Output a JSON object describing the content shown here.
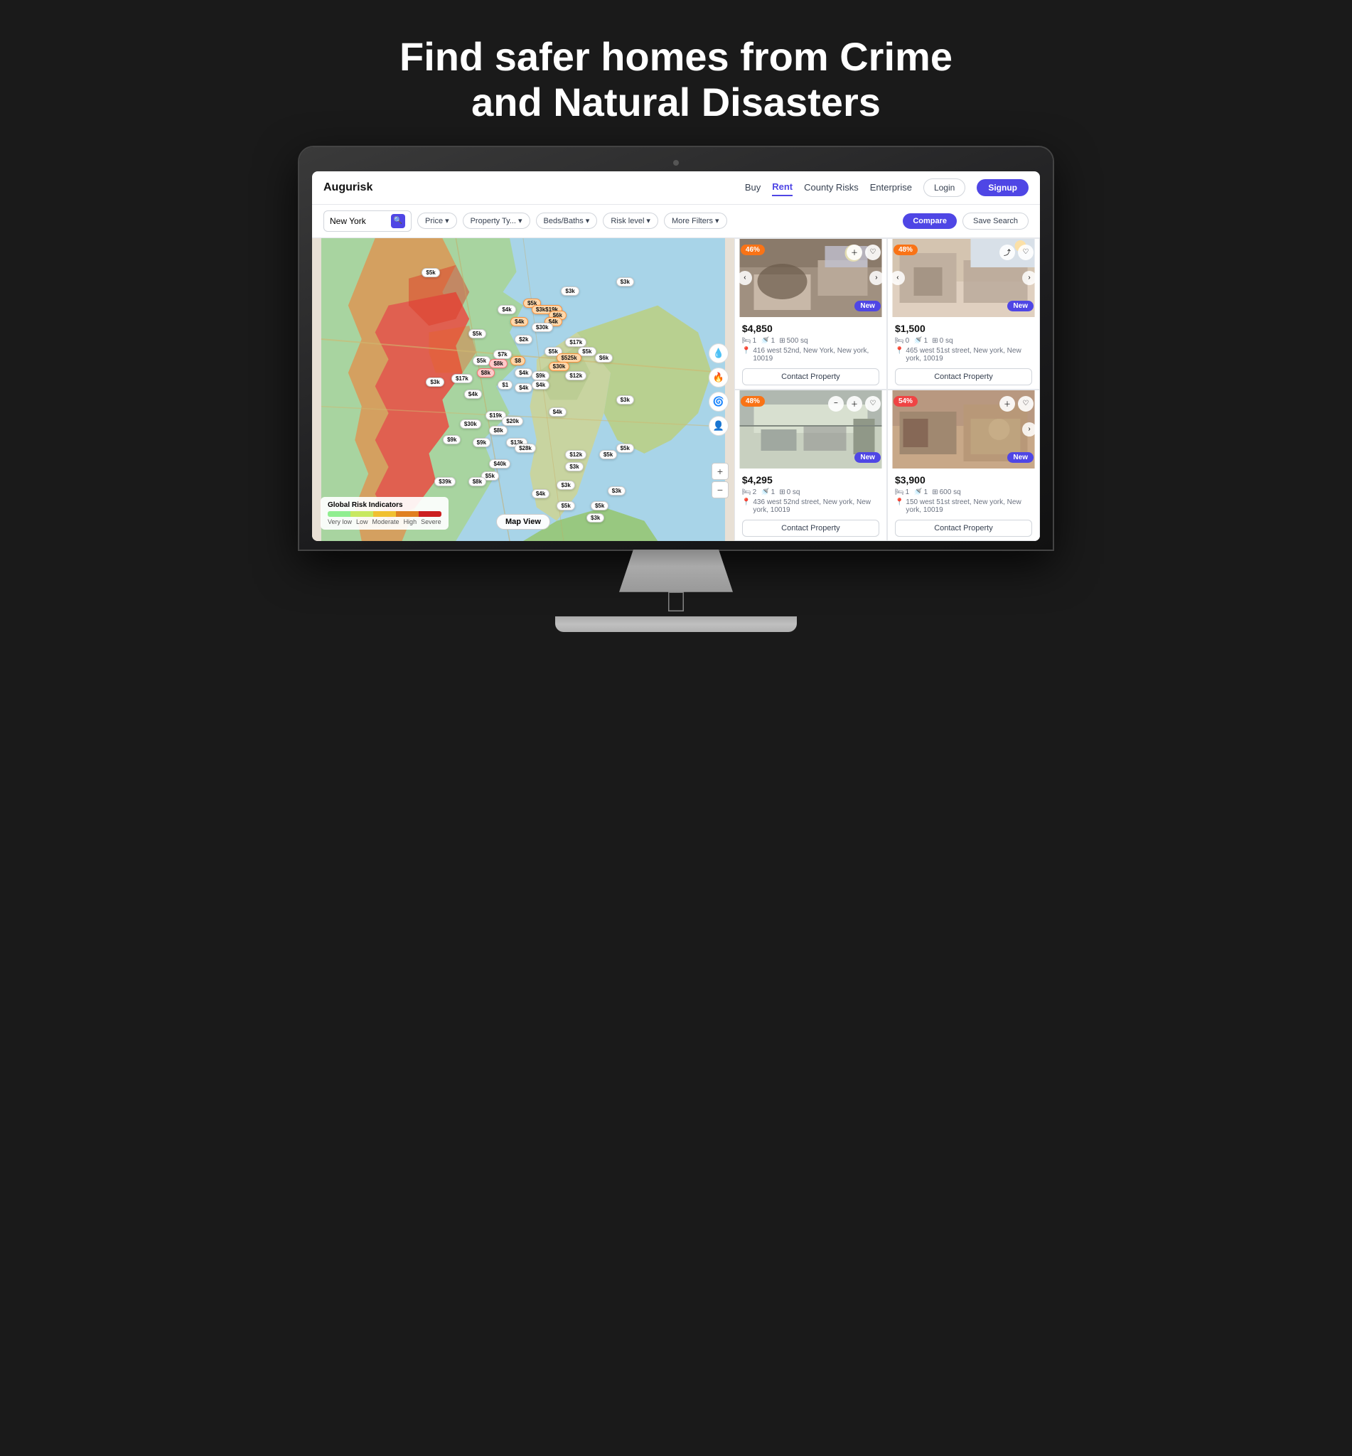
{
  "hero": {
    "title": "Find safer homes from Crime and Natural Disasters"
  },
  "navbar": {
    "brand": "Augurisk",
    "links": [
      {
        "id": "buy",
        "label": "Buy",
        "active": false
      },
      {
        "id": "rent",
        "label": "Rent",
        "active": true
      },
      {
        "id": "county-risks",
        "label": "County Risks",
        "active": false
      },
      {
        "id": "enterprise",
        "label": "Enterprise",
        "active": false
      }
    ],
    "login_label": "Login",
    "signup_label": "Signup"
  },
  "filterbar": {
    "search_value": "New York",
    "search_placeholder": "New York",
    "filters": [
      {
        "id": "price",
        "label": "Price"
      },
      {
        "id": "property-type",
        "label": "Property Ty..."
      },
      {
        "id": "beds-baths",
        "label": "Beds/Baths"
      },
      {
        "id": "risk-level",
        "label": "Risk level"
      },
      {
        "id": "more-filters",
        "label": "More Filters"
      }
    ],
    "compare_label": "Compare",
    "save_search_label": "Save Search"
  },
  "map": {
    "view_button": "Map View",
    "legend": {
      "title": "Global Risk Indicators",
      "labels": [
        "Very low",
        "Low",
        "Moderate",
        "High",
        "Severe"
      ]
    },
    "price_tags": [
      {
        "label": "$3k",
        "top": "13%",
        "left": "72%"
      },
      {
        "label": "$3k",
        "top": "16%",
        "left": "59%"
      },
      {
        "label": "$5k",
        "top": "20%",
        "left": "50%",
        "type": "orange"
      },
      {
        "label": "$3k19k",
        "top": "22%",
        "left": "52%",
        "type": "orange"
      },
      {
        "label": "$6k",
        "top": "23%",
        "left": "55%",
        "type": "orange"
      },
      {
        "label": "$4k",
        "top": "25%",
        "left": "47%",
        "type": "orange"
      },
      {
        "label": "$4k",
        "top": "25%",
        "left": "55%",
        "type": "orange"
      },
      {
        "label": "$4k",
        "top": "21%",
        "left": "45%"
      },
      {
        "label": "$30k",
        "top": "27%",
        "left": "52%"
      },
      {
        "label": "$17k",
        "top": "33%",
        "left": "60%"
      },
      {
        "label": "$2k",
        "top": "32%",
        "left": "48%"
      },
      {
        "label": "$5k",
        "top": "36%",
        "left": "55%"
      },
      {
        "label": "$5k",
        "top": "36%",
        "left": "63%"
      },
      {
        "label": "$5k",
        "top": "30%",
        "left": "38%"
      },
      {
        "label": "$7k",
        "top": "36%",
        "left": "43%"
      },
      {
        "label": "$5k",
        "top": "38%",
        "left": "39%"
      },
      {
        "label": "$5k",
        "top": "38%",
        "left": "46%"
      },
      {
        "label": "$8",
        "top": "38%",
        "left": "52%",
        "type": "orange"
      },
      {
        "label": "$6k",
        "top": "38%",
        "left": "68%"
      },
      {
        "label": "$525k",
        "top": "37%",
        "left": "57%"
      },
      {
        "label": "$30k",
        "top": "40%",
        "left": "55%"
      },
      {
        "label": "$4k",
        "top": "42%",
        "left": "48%"
      },
      {
        "label": "$9k",
        "top": "44%",
        "left": "52%"
      },
      {
        "label": "$12k",
        "top": "44%",
        "left": "60%"
      },
      {
        "label": "$8k",
        "top": "40%",
        "left": "42%"
      },
      {
        "label": "$8k",
        "top": "43%",
        "left": "40%"
      },
      {
        "label": "$17k",
        "top": "45%",
        "left": "34%"
      },
      {
        "label": "$1",
        "top": "46%",
        "left": "44%"
      },
      {
        "label": "$4k",
        "top": "48%",
        "left": "44%"
      },
      {
        "label": "$4k",
        "top": "46%",
        "left": "50%"
      },
      {
        "label": "$4k",
        "top": "50%",
        "left": "38%"
      },
      {
        "label": "$3k",
        "top": "52%",
        "left": "72%"
      },
      {
        "label": "$5k",
        "top": "12%",
        "left": "28%"
      },
      {
        "label": "$3k",
        "top": "46%",
        "left": "28%"
      },
      {
        "label": "$19k",
        "top": "57%",
        "left": "42%"
      },
      {
        "label": "$20k",
        "top": "59%",
        "left": "45%"
      },
      {
        "label": "$30k",
        "top": "60%",
        "left": "36%"
      },
      {
        "label": "$8k",
        "top": "62%",
        "left": "42%"
      },
      {
        "label": "$4k",
        "top": "56%",
        "left": "56%"
      },
      {
        "label": "$9k",
        "top": "65%",
        "left": "32%"
      },
      {
        "label": "$9k",
        "top": "66%",
        "left": "38%"
      },
      {
        "label": "$13k",
        "top": "66%",
        "left": "46%"
      },
      {
        "label": "$28k",
        "top": "68%",
        "left": "48%"
      },
      {
        "label": "$12k",
        "top": "70%",
        "left": "60%"
      },
      {
        "label": "$5k",
        "top": "70%",
        "left": "67%"
      },
      {
        "label": "$5k",
        "top": "68%",
        "left": "70%"
      },
      {
        "label": "$40k",
        "top": "73%",
        "left": "42%"
      },
      {
        "label": "$5k",
        "top": "77%",
        "left": "40%"
      },
      {
        "label": "$39k",
        "top": "79%",
        "left": "30%"
      },
      {
        "label": "$8k",
        "top": "79%",
        "left": "38%"
      },
      {
        "label": "$3k",
        "top": "74%",
        "left": "60%"
      },
      {
        "label": "$3k",
        "top": "80%",
        "left": "58%"
      },
      {
        "label": "$4k",
        "top": "83%",
        "left": "52%"
      },
      {
        "label": "$3k",
        "top": "82%",
        "left": "70%"
      },
      {
        "label": "$5k",
        "top": "87%",
        "left": "58%"
      },
      {
        "label": "$5k",
        "top": "87%",
        "left": "65%"
      },
      {
        "label": "$3k",
        "top": "91%",
        "left": "65%"
      }
    ]
  },
  "listings": [
    {
      "id": "listing-1",
      "risk_badge": "46%",
      "risk_type": "normal",
      "is_new": true,
      "price": "$4,850",
      "beds": "1",
      "baths": "1",
      "sqft": "500 sq",
      "address": "416 west 52nd, New York, New york, 10019",
      "contact_label": "Contact Property",
      "img_color": "#c8b8a2",
      "img_type": "living-room"
    },
    {
      "id": "listing-2",
      "risk_badge": "48%",
      "risk_type": "normal",
      "is_new": true,
      "price": "$1,500",
      "beds": "0",
      "baths": "1",
      "sqft": "0 sq",
      "address": "465 west 51st street, New york, New york, 10019",
      "contact_label": "Contact Property",
      "img_color": "#d4c4b0",
      "img_type": "bedroom"
    },
    {
      "id": "listing-3",
      "risk_badge": "48%",
      "risk_type": "normal",
      "is_new": true,
      "price": "$4,295",
      "beds": "2",
      "baths": "1",
      "sqft": "0 sq",
      "address": "436 west 52nd street, New york, New york, 10019",
      "contact_label": "Contact Property",
      "img_color": "#b8c4b8",
      "img_type": "kitchen"
    },
    {
      "id": "listing-4",
      "risk_badge": "54%",
      "risk_type": "high",
      "is_new": true,
      "price": "$3,900",
      "beds": "1",
      "baths": "1",
      "sqft": "600 sq",
      "address": "150 west 51st street, New york, New york, 10019",
      "contact_label": "Contact Property",
      "img_color": "#c4a898",
      "img_type": "living-room-2"
    }
  ]
}
